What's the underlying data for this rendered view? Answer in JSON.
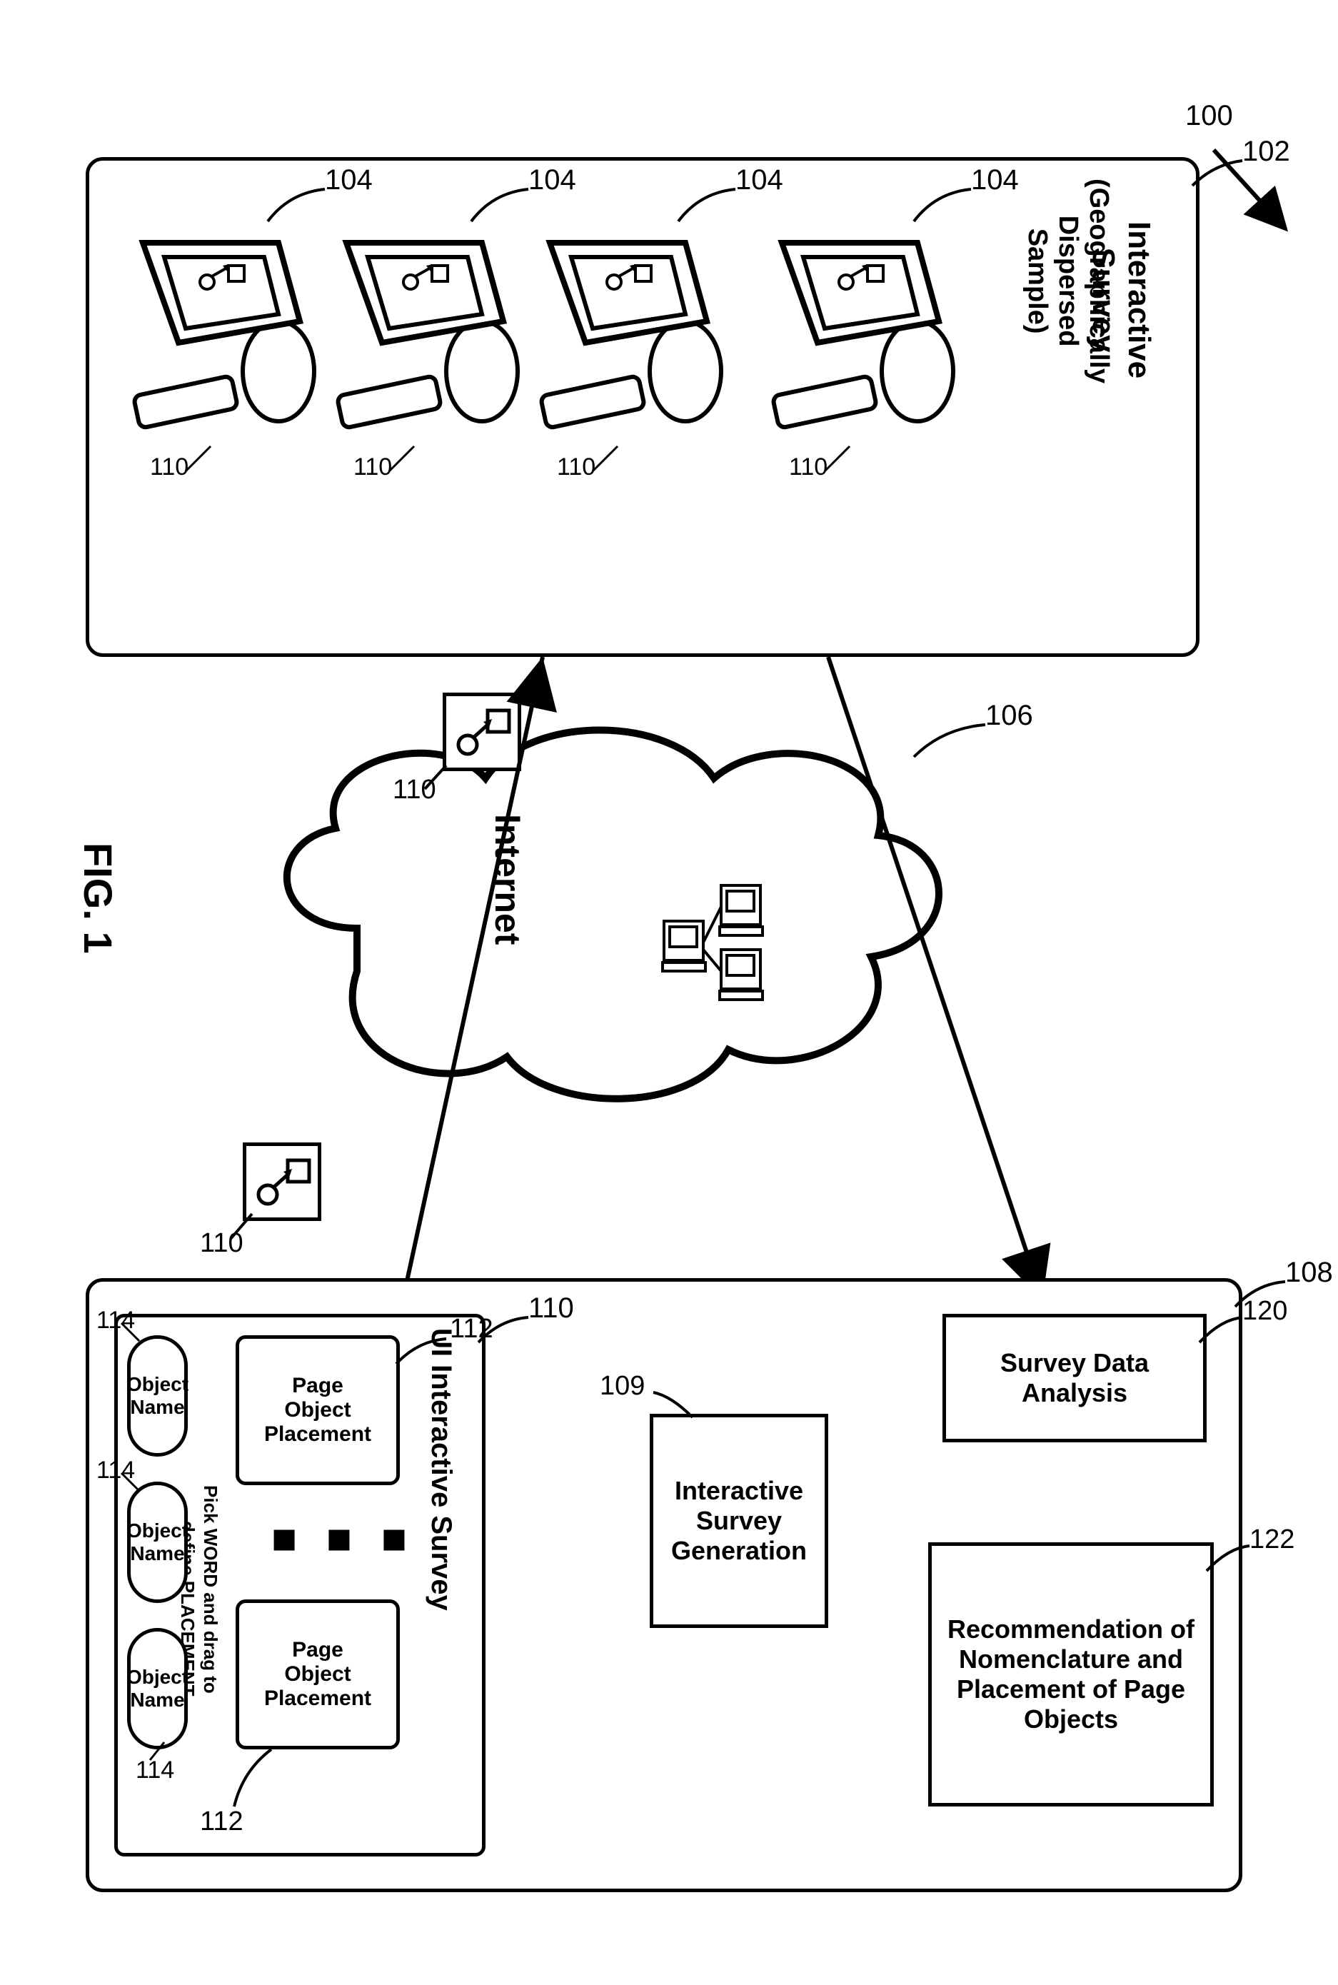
{
  "figure_label": "FIG. 1",
  "callouts": {
    "overall": "100",
    "top_box": "102",
    "workstation": "104",
    "cloud": "106",
    "bottom_box": "108",
    "survey_gen": "109",
    "icon_card": "110",
    "placement_cell": "112",
    "object_name": "114",
    "analysis": "120",
    "recommendation": "122"
  },
  "top_box": {
    "title_line1": "Interactive Survey",
    "title_line2": "(Geographically Dispersed Sample)"
  },
  "internet_label": "Internet",
  "survey_panel": {
    "title": "UI Interactive Survey",
    "placement_label": "Page\nObject\nPlacement",
    "instruction_line1": "Pick WORD and drag to",
    "instruction_line2": "define PLACEMENT",
    "object_name_label": "Object\nName"
  },
  "survey_gen_label": "Interactive\nSurvey\nGeneration",
  "analysis_label": "Survey Data Analysis",
  "recommendation_label": "Recommendation of\nNomenclature and\nPlacement of Page\nObjects"
}
